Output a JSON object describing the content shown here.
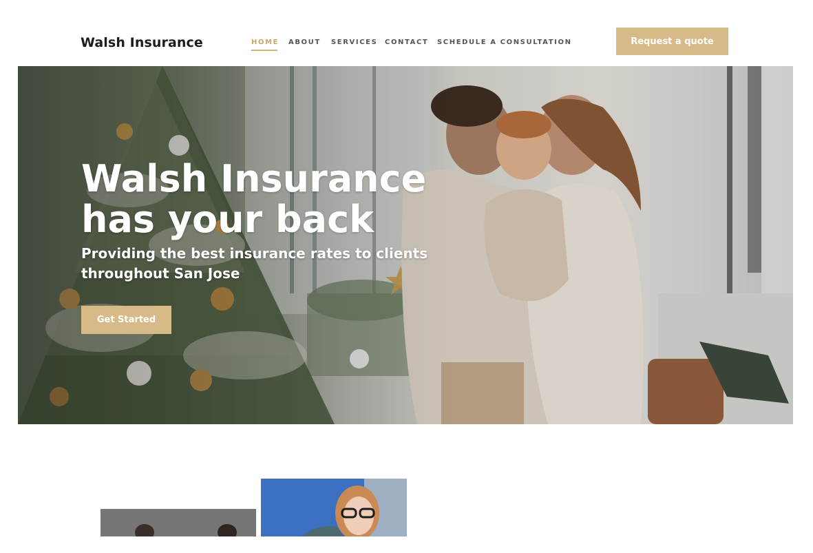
{
  "brand": {
    "name": "Walsh Insurance"
  },
  "nav": {
    "items": [
      {
        "label": "HOME",
        "active": true
      },
      {
        "label": "ABOUT",
        "active": false
      },
      {
        "label": "SERVICES",
        "active": false
      },
      {
        "label": "CONTACT",
        "active": false
      },
      {
        "label": "SCHEDULE A CONSULTATION",
        "active": false
      }
    ]
  },
  "header": {
    "cta_label": "Request a quote"
  },
  "hero": {
    "title": "Walsh Insurance has your back",
    "subtitle": "Providing the best insurance rates to clients throughout San Jose",
    "button_label": "Get Started"
  },
  "colors": {
    "accent": "#d6bb89",
    "active_nav": "#c9a56a",
    "text_dark": "#1c1c1c"
  }
}
